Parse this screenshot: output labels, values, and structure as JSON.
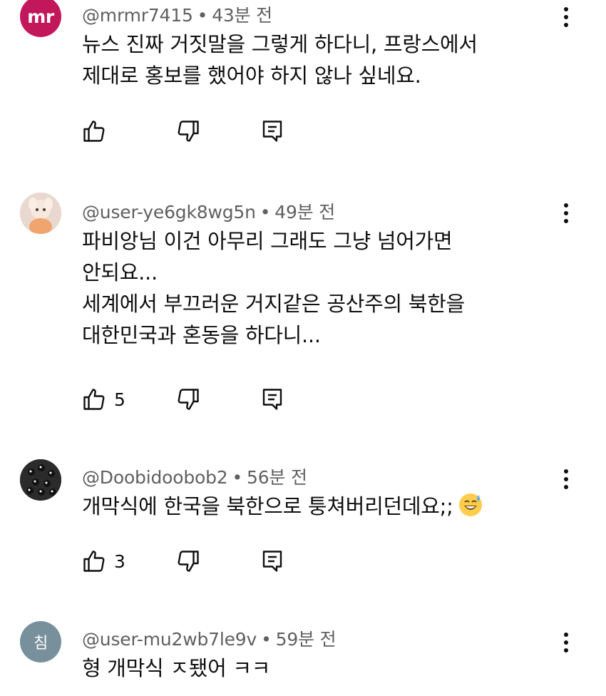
{
  "comments": [
    {
      "avatar_text": "mr",
      "avatar_color": "#c2185b",
      "handle": "@mrmr7415",
      "separator": "•",
      "time": "43분 전",
      "text": "뉴스 진짜 거짓말을 그렇게 하다니, 프랑스에서\n제대로 홍보를 했어야 하지 않나 싶네요.",
      "likes": ""
    },
    {
      "avatar_text": "",
      "avatar_color": "#f3d9cc",
      "handle": "@user-ye6gk8wg5n",
      "separator": "•",
      "time": "49분 전",
      "text": "파비앙님 이건 아무리 그래도 그냥 넘어가면\n안되요...\n세계에서 부끄러운 거지같은 공산주의 북한을\n대한민국과 혼동을 하다니...",
      "likes": "5"
    },
    {
      "avatar_text": "",
      "avatar_color": "#2a2a2a",
      "handle": "@Doobidoobob2",
      "separator": "•",
      "time": "56분 전",
      "text": "개막식에 한국을 북한으로 퉁쳐버리던데요;;",
      "emoji": "sweat-smile-emoji",
      "likes": "3"
    },
    {
      "avatar_text": "침",
      "avatar_color": "#78909c",
      "handle": "@user-mu2wb7le9v",
      "separator": "•",
      "time": "59분 전",
      "text": "형 개막식 ㅈ됐어 ㅋㅋ",
      "likes": ""
    }
  ],
  "icons": {
    "like": "thumbs-up-icon",
    "dislike": "thumbs-down-icon",
    "reply": "reply-icon",
    "more": "more-vert-icon"
  }
}
